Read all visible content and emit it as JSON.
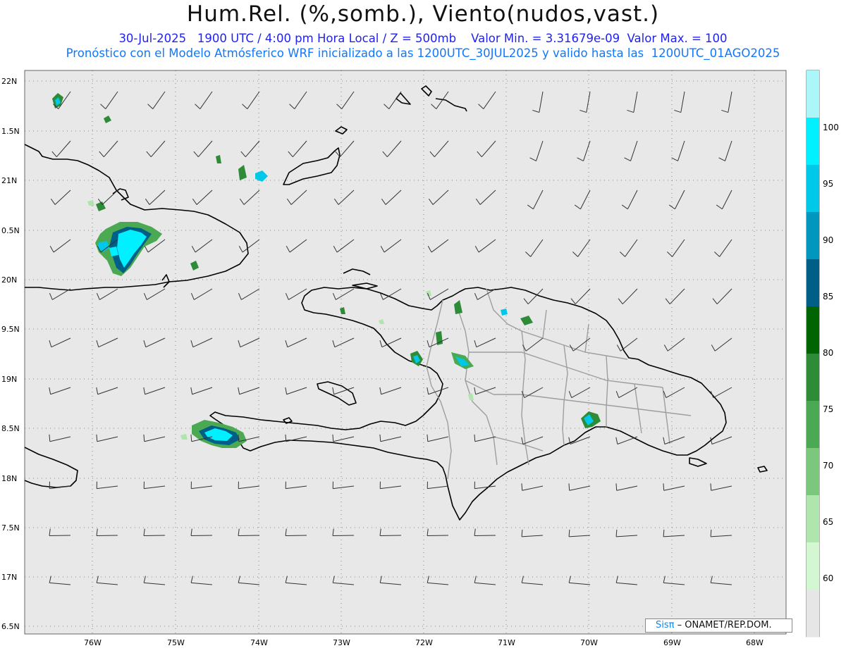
{
  "header": {
    "title": "Hum.Rel. (%,somb.), Viento(nudos,vast.)",
    "line1": "30-Jul-2025   1900 UTC / 4:00 pm Hora Local / Z = 500mb    Valor Min. = 3.31679e-09  Valor Max. = 100",
    "line2": "Pronóstico con el Modelo Atmósferico WRF inicializado a las 1200UTC_30JUL2025 y valido hasta las  1200UTC_01AGO2025"
  },
  "axes": {
    "lat_labels": [
      "22N",
      "1.5N",
      "21N",
      "0.5N",
      "20N",
      "9.5N",
      "19N",
      "8.5N",
      "18N",
      "7.5N",
      "17N",
      "6.5N"
    ],
    "lon_labels": [
      "76W",
      "75W",
      "74W",
      "73W",
      "72W",
      "71W",
      "70W",
      "69W",
      "68W"
    ]
  },
  "colorbar": {
    "labels": [
      "100",
      "95",
      "90",
      "85",
      "80",
      "75",
      "70",
      "65",
      "60"
    ],
    "colors": [
      "#aaf6f8",
      "#00f0ff",
      "#00c8e8",
      "#0096be",
      "#005f87",
      "#006400",
      "#2e8b38",
      "#4aa952",
      "#7bc87c",
      "#aee6ac",
      "#d3f7d0",
      "#e6e6e6"
    ]
  },
  "credit": {
    "brand": "Sisπ",
    "text": "– ONAMET/REP.DOM."
  }
}
